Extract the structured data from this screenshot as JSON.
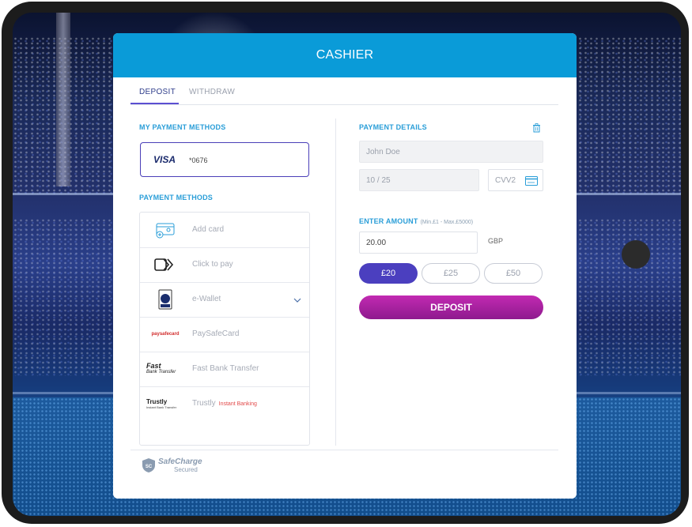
{
  "modal": {
    "title": "CASHIER",
    "tabs": [
      {
        "label": "DEPOSIT",
        "active": true
      },
      {
        "label": "WITHDRAW",
        "active": false
      }
    ]
  },
  "left": {
    "my_methods_label": "MY PAYMENT METHODS",
    "saved_card": {
      "brand": "VISA",
      "number": "*0676"
    },
    "payment_methods_label": "PAYMENT METHODS",
    "methods": [
      {
        "label": "Add card",
        "icon": "add-card-icon"
      },
      {
        "label": "Click to pay",
        "icon": "click-to-pay-icon"
      },
      {
        "label": "e-Wallet",
        "icon": "ewallet-card-icon",
        "expandable": true
      },
      {
        "label": "PaySafeCard",
        "icon": "paysafecard-logo",
        "logo_text": "paysafecard"
      },
      {
        "label": "Fast Bank Transfer",
        "icon": "fast-bank-transfer-logo",
        "logo_line1": "Fast",
        "logo_line2": "Bank Transfer"
      },
      {
        "label": "Trustly",
        "sublabel": "Instant Banking",
        "icon": "trustly-logo",
        "logo_line1": "Trustly",
        "logo_line2": "Instant Bank Transfer"
      }
    ]
  },
  "right": {
    "details_label": "PAYMENT DETAILS",
    "name_value": "John Doe",
    "expiry_value": "10 / 25",
    "cvv_placeholder": "CVV2",
    "amount_label": "ENTER AMOUNT",
    "amount_range": "(Min.£1 - Max.£5000)",
    "amount_value": "20.00",
    "currency": "GBP",
    "quick_amounts": [
      {
        "label": "£20",
        "active": true
      },
      {
        "label": "£25",
        "active": false
      },
      {
        "label": "£50",
        "active": false
      }
    ],
    "deposit_button": "DEPOSIT"
  },
  "footer": {
    "badge_text": "SC",
    "brand": "SafeCharge",
    "tagline": "Secured"
  },
  "colors": {
    "header": "#0a9bd8",
    "section_label": "#2a9ed8",
    "active_chip": "#4b3fbf",
    "deposit_button": "#b022a8"
  }
}
